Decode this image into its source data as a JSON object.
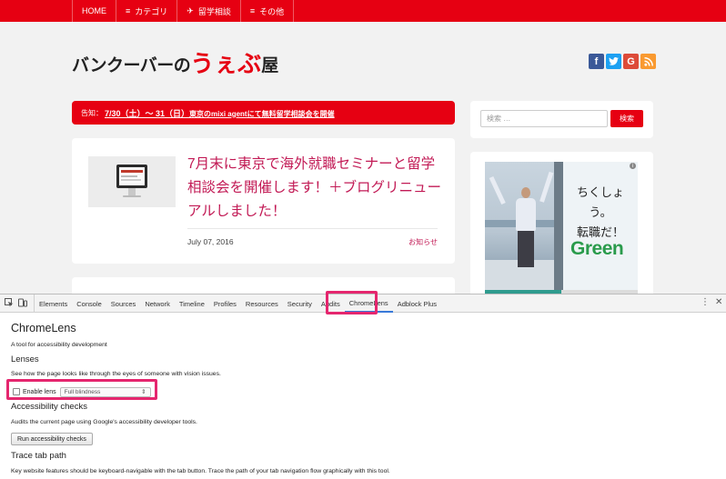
{
  "site": {
    "nav": [
      {
        "icon": "",
        "label": "HOME"
      },
      {
        "icon": "≡",
        "label": "カテゴリ"
      },
      {
        "icon": "✈",
        "label": "留学相談"
      },
      {
        "icon": "≡",
        "label": "その他"
      }
    ],
    "logo": {
      "part1": "バンクーバーの",
      "part2": "うぇぶ",
      "part3": "屋"
    },
    "social": [
      "f",
      "t",
      "G",
      "rss"
    ],
    "notice": {
      "label": "告知：",
      "link_a": "7/30（土）〜 31（日）",
      "link_b": "東京のmixi agentにて無料留学相談会を開催"
    },
    "post": {
      "title": "7月末に東京で海外就職セミナーと留学相談会を開催します！＋ブログリニューアルしました！",
      "date": "July 07, 2016",
      "category": "お知らせ"
    },
    "search": {
      "placeholder": "検索 …",
      "button": "検索"
    },
    "ad": {
      "line1": "ちくしょう。",
      "line2": "転職だ！",
      "brand_g": "G",
      "brand_rest": "reen",
      "info": "i"
    }
  },
  "devtools": {
    "tabs": [
      "Elements",
      "Console",
      "Sources",
      "Network",
      "Timeline",
      "Profiles",
      "Resources",
      "Security",
      "Audits",
      "ChromeLens",
      "Adblock Plus"
    ],
    "active_tab": "ChromeLens",
    "panel": {
      "title": "ChromeLens",
      "subtitle": "A tool for accessibility development",
      "lenses_heading": "Lenses",
      "lenses_desc": "See how the page looks like through the eyes of someone with vision issues.",
      "enable_lens_label": "Enable lens",
      "lens_select_value": "Full blindness",
      "checks_heading": "Accessibility checks",
      "checks_desc": "Audits the current page using Google's accessibility developer tools.",
      "run_button": "Run accessibility checks",
      "trace_heading": "Trace tab path",
      "trace_desc": "Key website features should be keyboard-navigable with the tab button. Trace the path of your tab navigation flow graphically with this tool."
    }
  },
  "colors": {
    "brand_red": "#e60012",
    "post_title": "#c21a55",
    "highlight": "#e5266e",
    "tab_underline": "#3879d9"
  }
}
